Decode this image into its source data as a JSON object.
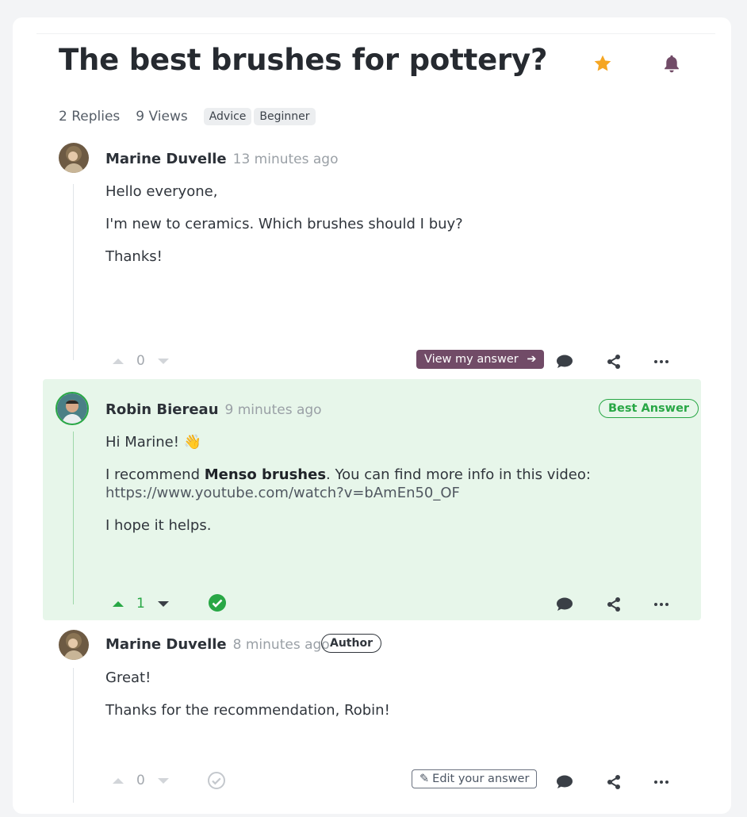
{
  "question": {
    "title": "The best brushes for pottery?",
    "replies": "2 Replies",
    "views": "9 Views",
    "tags": [
      "Advice",
      "Beginner"
    ],
    "favorite_icon": "star-icon",
    "follow_icon": "bell-icon"
  },
  "posts": [
    {
      "author": "Marine Duvelle",
      "time": "13 minutes ago",
      "paragraphs": [
        "Hello everyone,",
        "I'm new to ceramics. Which brushes should I buy?",
        "Thanks!"
      ],
      "votes": "0",
      "view_answer_label": "View my answer"
    },
    {
      "author": "Robin Biereau",
      "time": "9 minutes ago",
      "badge": "Best Answer",
      "greeting": "Hi Marine! 👋",
      "p2_before": "I recommend ",
      "p2_bold": "Menso brushes",
      "p2_after": ". You can find more info in this video:",
      "link": "https://www.youtube.com/watch?v=bAmEn50_OF",
      "p3": "I hope it helps.",
      "votes": "1"
    },
    {
      "author": "Marine Duvelle",
      "time": "8 minutes ago",
      "badge": "Author",
      "paragraphs": [
        "Great!",
        "Thanks for the recommendation, Robin!"
      ],
      "votes": "0",
      "edit_label": "Edit your answer"
    }
  ],
  "colors": {
    "brand": "#714b67",
    "accent_star": "#f5a623",
    "success": "#28a745",
    "best_bg": "#e7f6ea"
  }
}
